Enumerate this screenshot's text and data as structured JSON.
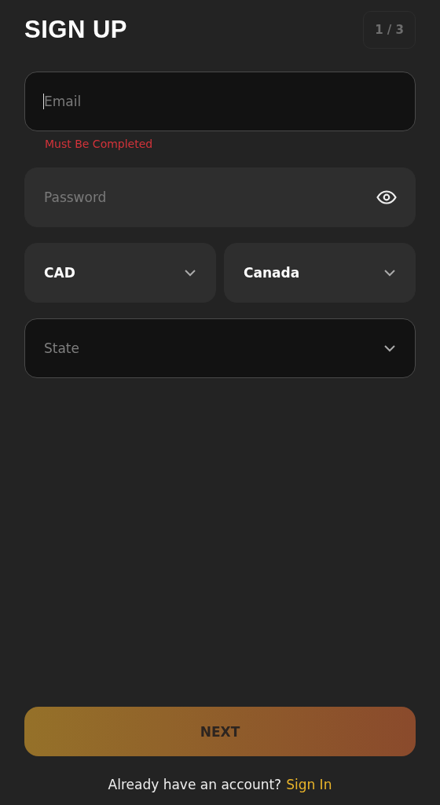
{
  "header": {
    "title": "SIGN UP",
    "step": "1 / 3"
  },
  "email": {
    "placeholder": "Email",
    "outlined": true,
    "focused": true,
    "error": "Must Be Completed"
  },
  "password": {
    "placeholder": "Password",
    "outlined": false
  },
  "selects": [
    {
      "value": "CAD",
      "outlined": false
    },
    {
      "value": "Canada",
      "outlined": false
    }
  ],
  "state": {
    "placeholder": "State",
    "outlined": true
  },
  "next_button": {
    "label": "NEXT"
  },
  "footer": {
    "text": "Already have an account?",
    "link": "Sign In"
  }
}
